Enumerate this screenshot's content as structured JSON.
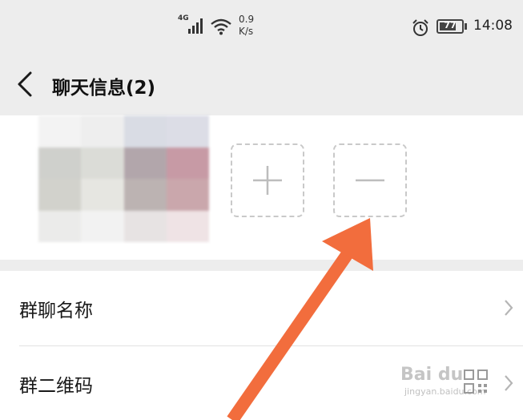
{
  "status_bar": {
    "network": "4G",
    "speed_value": "0.9",
    "speed_unit": "K/s",
    "battery": "77",
    "battery_level": 0.77,
    "time": "14:08"
  },
  "nav": {
    "title": "聊天信息(2)"
  },
  "members": {
    "add_icon": "plus-icon",
    "remove_icon": "minus-icon"
  },
  "settings": {
    "rows": [
      {
        "label": "群聊名称"
      },
      {
        "label": "群二维码"
      }
    ]
  },
  "watermark": {
    "brand": "Bai du",
    "site": "jingyan.baidu.com"
  },
  "colors": {
    "background": "#ededed",
    "card": "#ffffff",
    "arrow": "#f26d3d",
    "dashed_border": "#c9c9c9"
  }
}
